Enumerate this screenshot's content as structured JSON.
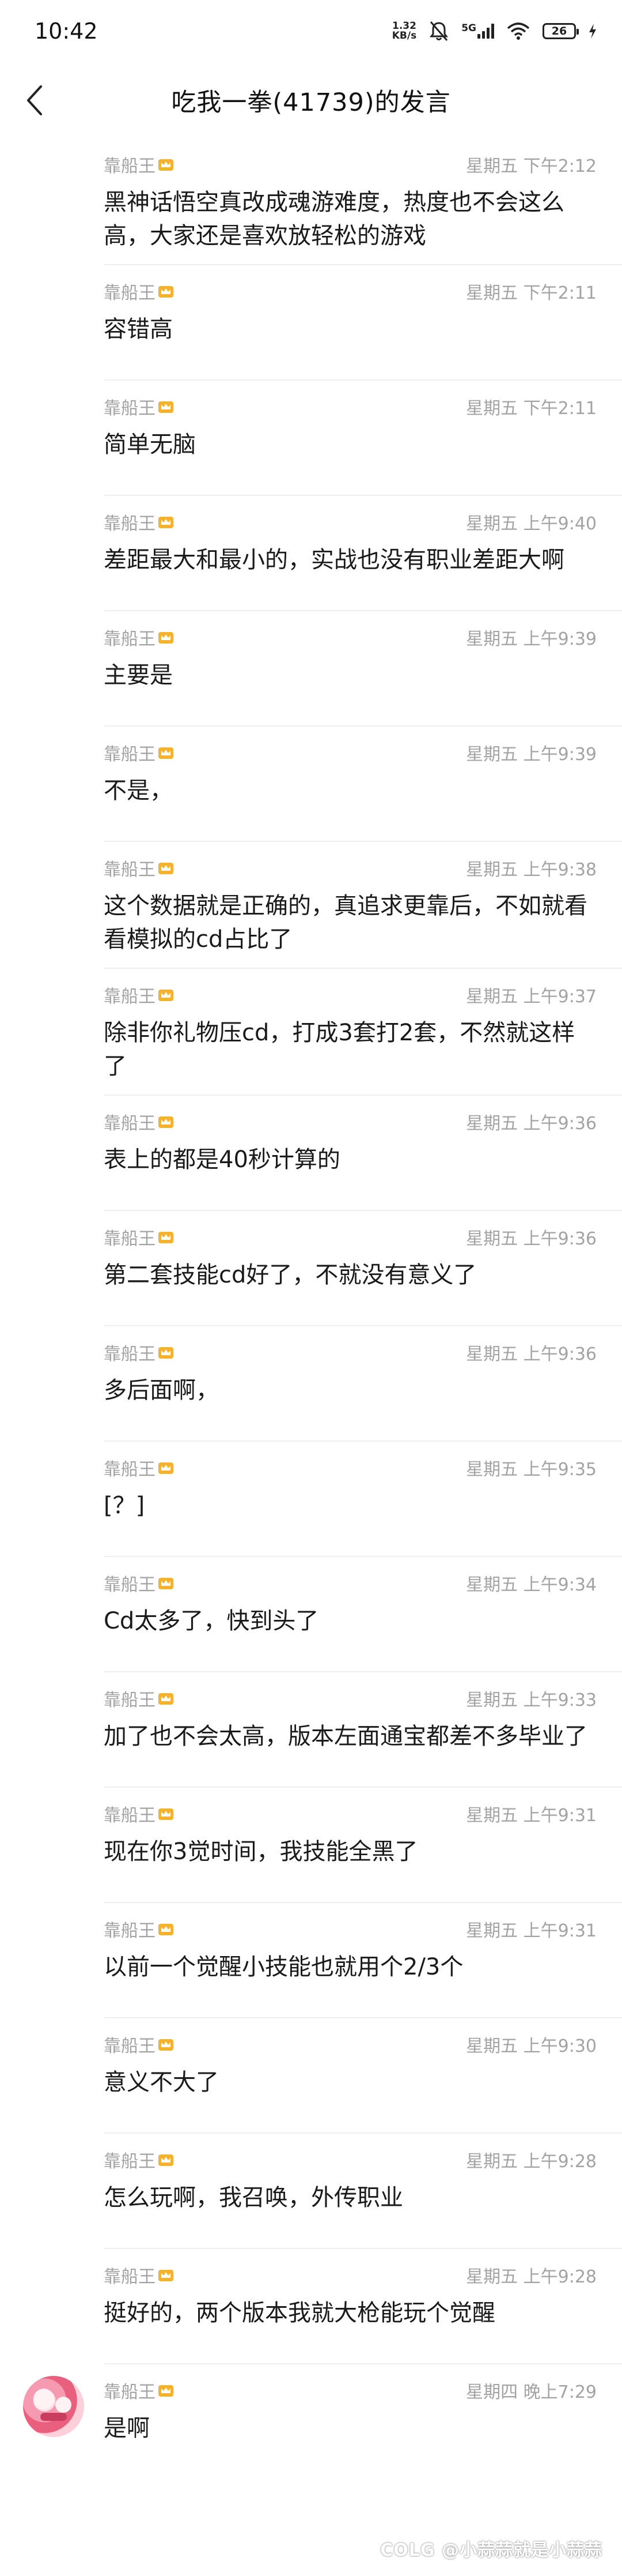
{
  "status_bar": {
    "time": "10:42",
    "net_speed_value": "1.32",
    "net_speed_unit": "KB/s",
    "network": "5G",
    "battery": "26"
  },
  "header": {
    "title": "吃我一拳(41739)的发言"
  },
  "author_name": "靠船王",
  "messages": [
    {
      "author": "靠船王",
      "time": "星期五 下午2:12",
      "text": "黑神话悟空真改成魂游难度，热度也不会这么高，大家还是喜欢放轻松的游戏"
    },
    {
      "author": "靠船王",
      "time": "星期五 下午2:11",
      "text": "容错高"
    },
    {
      "author": "靠船王",
      "time": "星期五 下午2:11",
      "text": "简单无脑"
    },
    {
      "author": "靠船王",
      "time": "星期五 上午9:40",
      "text": "差距最大和最小的，实战也没有职业差距大啊"
    },
    {
      "author": "靠船王",
      "time": "星期五 上午9:39",
      "text": "主要是"
    },
    {
      "author": "靠船王",
      "time": "星期五 上午9:39",
      "text": "不是，"
    },
    {
      "author": "靠船王",
      "time": "星期五 上午9:38",
      "text": "这个数据就是正确的，真追求更靠后，不如就看看模拟的cd占比了"
    },
    {
      "author": "靠船王",
      "time": "星期五 上午9:37",
      "text": "除非你礼物压cd，打成3套打2套，不然就这样了"
    },
    {
      "author": "靠船王",
      "time": "星期五 上午9:36",
      "text": "表上的都是40秒计算的"
    },
    {
      "author": "靠船王",
      "time": "星期五 上午9:36",
      "text": "第二套技能cd好了，不就没有意义了"
    },
    {
      "author": "靠船王",
      "time": "星期五 上午9:36",
      "text": "多后面啊，"
    },
    {
      "author": "靠船王",
      "time": "星期五 上午9:35",
      "text": "[？]"
    },
    {
      "author": "靠船王",
      "time": "星期五 上午9:34",
      "text": "Cd太多了，快到头了"
    },
    {
      "author": "靠船王",
      "time": "星期五 上午9:33",
      "text": "加了也不会太高，版本左面通宝都差不多毕业了"
    },
    {
      "author": "靠船王",
      "time": "星期五 上午9:31",
      "text": "现在你3觉时间，我技能全黑了"
    },
    {
      "author": "靠船王",
      "time": "星期五 上午9:31",
      "text": "以前一个觉醒小技能也就用个2/3个"
    },
    {
      "author": "靠船王",
      "time": "星期五 上午9:30",
      "text": "意义不大了"
    },
    {
      "author": "靠船王",
      "time": "星期五 上午9:28",
      "text": "怎么玩啊，我召唤，外传职业"
    },
    {
      "author": "靠船王",
      "time": "星期五 上午9:28",
      "text": "挺好的，两个版本我就大枪能玩个觉醒"
    },
    {
      "author": "靠船王",
      "time": "星期四 晚上7:29",
      "text": "是啊"
    }
  ],
  "watermark": "COLG @小蒜蒜就是小蒜蒜",
  "icons": {
    "back": "chevron-left-icon",
    "crown": "crown-badge-icon",
    "mute": "bell-off-icon",
    "wifi": "wifi-icon",
    "charging": "bolt-icon"
  },
  "colors": {
    "meta_text": "#a3a3a3",
    "body_text": "#1a1a1a",
    "divider": "#f0f0f0",
    "crown": "#f3b32f"
  }
}
